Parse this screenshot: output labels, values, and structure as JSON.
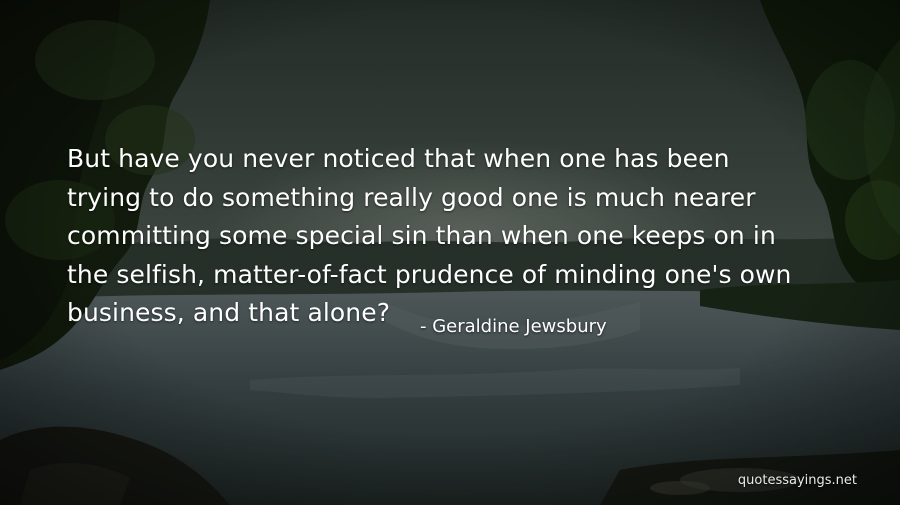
{
  "quote": {
    "lines": [
      "But have you never noticed that when one has been",
      "trying to do something really good one is much nearer",
      "committing some special sin than when one keeps on in",
      "the selfish, matter-of-fact prudence of minding one's own",
      "business, and that alone?"
    ],
    "author": "- Geraldine Jewsbury"
  },
  "watermark": "quotessayings.net",
  "colors": {
    "text": "#ffffff",
    "sky": "#3e4a42",
    "forest": "#1b2a1c",
    "water": "#4a5a60"
  }
}
